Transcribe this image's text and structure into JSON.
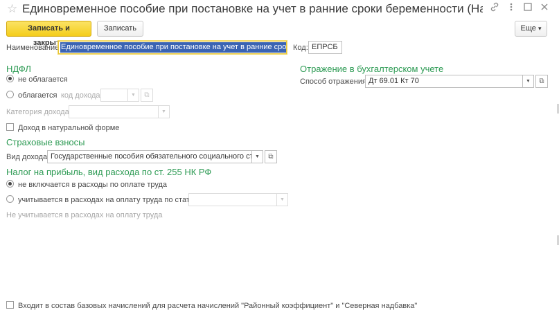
{
  "window": {
    "title": "Единовременное пособие при постановке на учет в ранние сроки беременности (Начисле...",
    "star_icon": "star-icon",
    "icons": [
      "link-icon",
      "more-vertical-icon",
      "window-icon",
      "close-icon"
    ]
  },
  "toolbar": {
    "save_close_label": "Записать и закрыть",
    "save_label": "Записать",
    "more_label": "Еще",
    "more_arrow": "▾"
  },
  "name_row": {
    "name_label": "Наименование:",
    "name_value": "Единовременное пособие при постановке на учет в ранние сроки бер",
    "code_label": "Код:",
    "code_value": "ЕПРСБ"
  },
  "ndfl": {
    "heading": "НДФЛ",
    "option_not_taxed": "не облагается",
    "option_taxed": "облагается",
    "income_code_label": "код дохода:",
    "income_code_value": "",
    "income_category_label": "Категория дохода:",
    "income_category_value": "",
    "in_kind_label": "Доход в натуральной форме",
    "selected": "not_taxed"
  },
  "insurance": {
    "heading": "Страховые взносы",
    "income_type_label": "Вид дохода:",
    "income_type_value": "Государственные пособия обязательного социального страхов"
  },
  "profit_tax": {
    "heading": "Налог на прибыль, вид расхода по ст. 255 НК РФ",
    "option_excluded": "не включается в расходы по оплате труда",
    "option_included": "учитывается в расходах на оплату труда по статье:",
    "article_value": "",
    "note": "Не учитывается в расходах на оплату труда",
    "selected": "excluded"
  },
  "accounting": {
    "heading": "Отражение в бухгалтерском учете",
    "method_label": "Способ отражения:",
    "method_value": "Дт 69.01 Кт 70"
  },
  "footer": {
    "base_accruals_label": "Входит в состав базовых начислений для расчета начислений \"Районный коэффициент\" и \"Северная надбавка\""
  },
  "glyphs": {
    "dropdown": "▼",
    "open": "⧉"
  }
}
